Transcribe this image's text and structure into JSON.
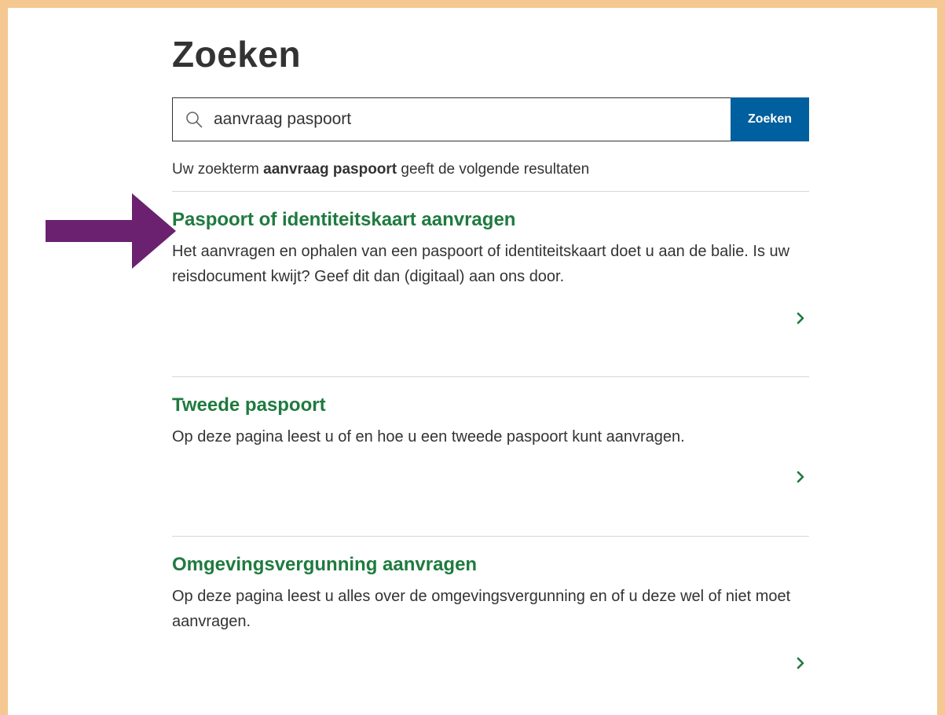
{
  "page": {
    "title": "Zoeken"
  },
  "search": {
    "icon": "search-icon",
    "value": "aanvraag paspoort",
    "button_label": "Zoeken"
  },
  "summary": {
    "prefix": "Uw zoekterm ",
    "term": "aanvraag paspoort",
    "suffix": " geeft de volgende resultaten"
  },
  "results": [
    {
      "title": "Paspoort of identiteitskaart aanvragen",
      "description": "Het aanvragen en ophalen van een paspoort of identiteitskaart doet u aan de balie. Is uw reisdocument kwijt? Geef dit dan (digitaal) aan ons door.",
      "chevron_icon": "chevron-right-icon"
    },
    {
      "title": "Tweede paspoort",
      "description": "Op deze pagina leest u of en hoe u een tweede paspoort kunt aanvragen.",
      "chevron_icon": "chevron-right-icon"
    },
    {
      "title": "Omgevingsvergunning aanvragen",
      "description": "Op deze pagina leest u alles over de omgevingsvergunning en of u deze wel of niet moet aanvragen.",
      "chevron_icon": "chevron-right-icon"
    }
  ],
  "colors": {
    "frame_border": "#f5c892",
    "search_button": "#005f9e",
    "result_link": "#1f7a3f",
    "annotation_arrow": "#6b2070"
  },
  "annotation": {
    "icon": "purple-arrow-icon"
  }
}
